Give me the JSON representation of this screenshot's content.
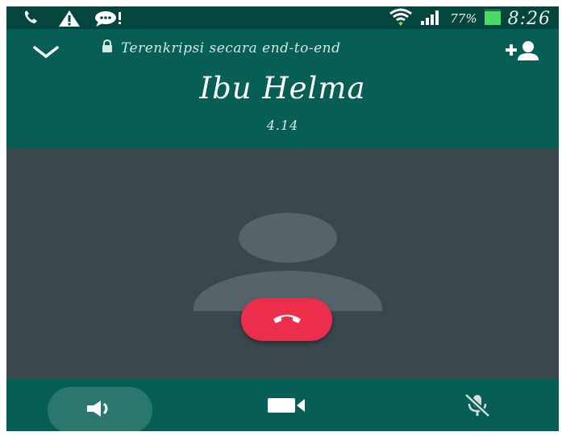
{
  "status_bar": {
    "battery_percent": "77%",
    "time": "8:26",
    "icons": [
      "phone-call-icon",
      "warning-icon",
      "chat-notification-icon",
      "wifi-icon",
      "signal-icon",
      "battery-icon"
    ]
  },
  "call_header": {
    "encryption_label": "Terenkripsi secara end-to-end",
    "contact_name": "Ibu Helma",
    "duration": "4.14"
  },
  "icons": {
    "minimize": "chevron-down-icon",
    "add_participant": "add-person-icon",
    "end_call": "end-call-icon",
    "speaker": "speaker-icon",
    "video": "video-camera-icon",
    "mute": "mic-off-icon"
  },
  "colors": {
    "header_bg": "#075e54",
    "stage_bg": "#3a474d",
    "end_call": "#eb2f4b",
    "speaker_active": "#2a776d",
    "battery": "#4cd964"
  }
}
